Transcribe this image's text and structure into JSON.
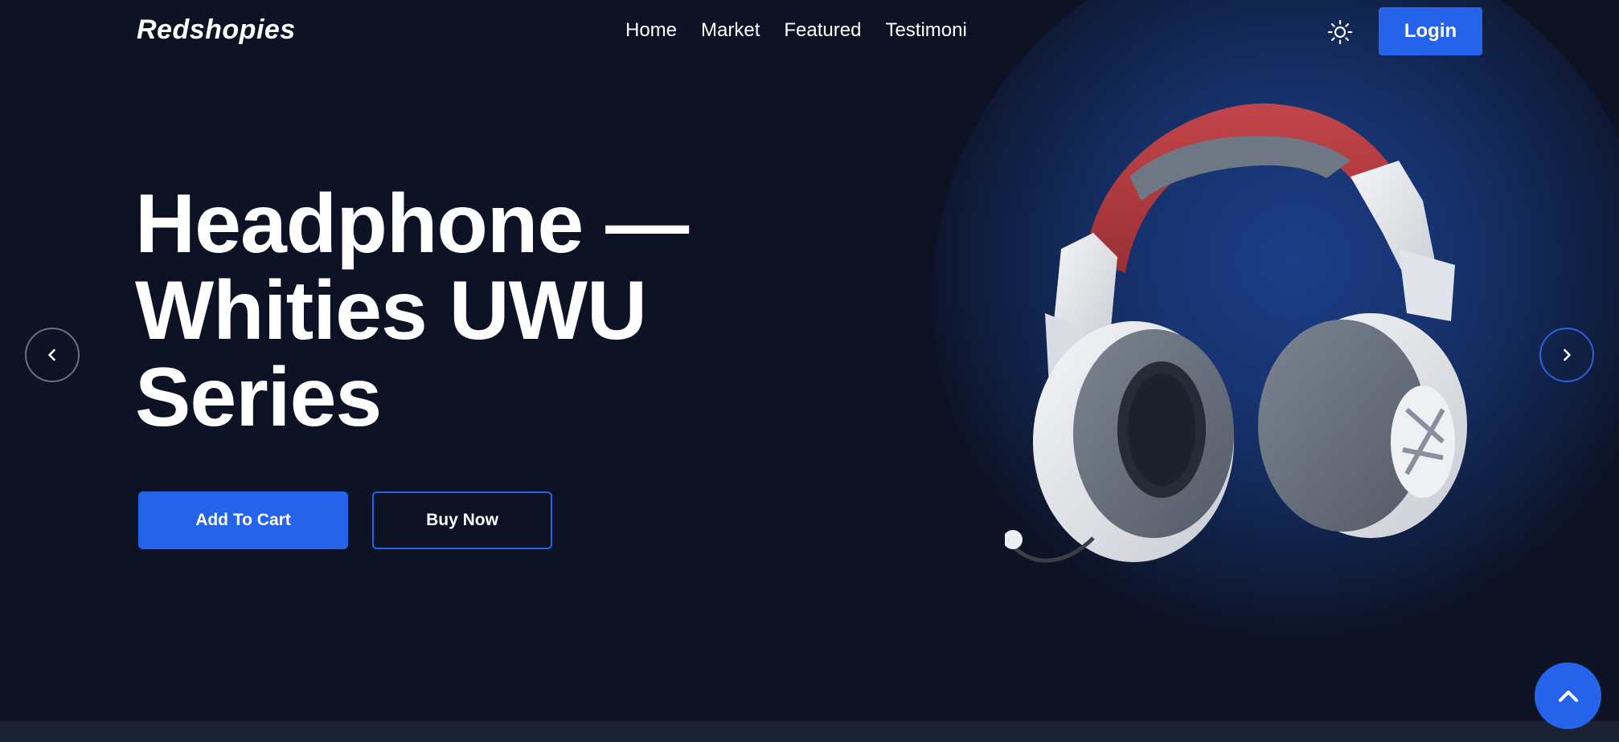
{
  "header": {
    "brand": "Redshopies",
    "nav": [
      "Home",
      "Market",
      "Featured",
      "Testimoni"
    ],
    "theme_icon": "sun-icon",
    "login_label": "Login"
  },
  "hero": {
    "title_lines": [
      "Headphone —",
      "Whities UWU",
      "Series"
    ],
    "add_to_cart_label": "Add To Cart",
    "buy_now_label": "Buy Now"
  },
  "carousel": {
    "prev_icon": "chevron-left-icon",
    "next_icon": "chevron-right-icon"
  },
  "scroll_top_icon": "chevron-up-icon",
  "colors": {
    "background": "#0d1224",
    "accent": "#2563eb",
    "headphone_band": "#b33a3f",
    "headphone_body": "#e8eaee",
    "headphone_cushion": "#6b7480"
  }
}
